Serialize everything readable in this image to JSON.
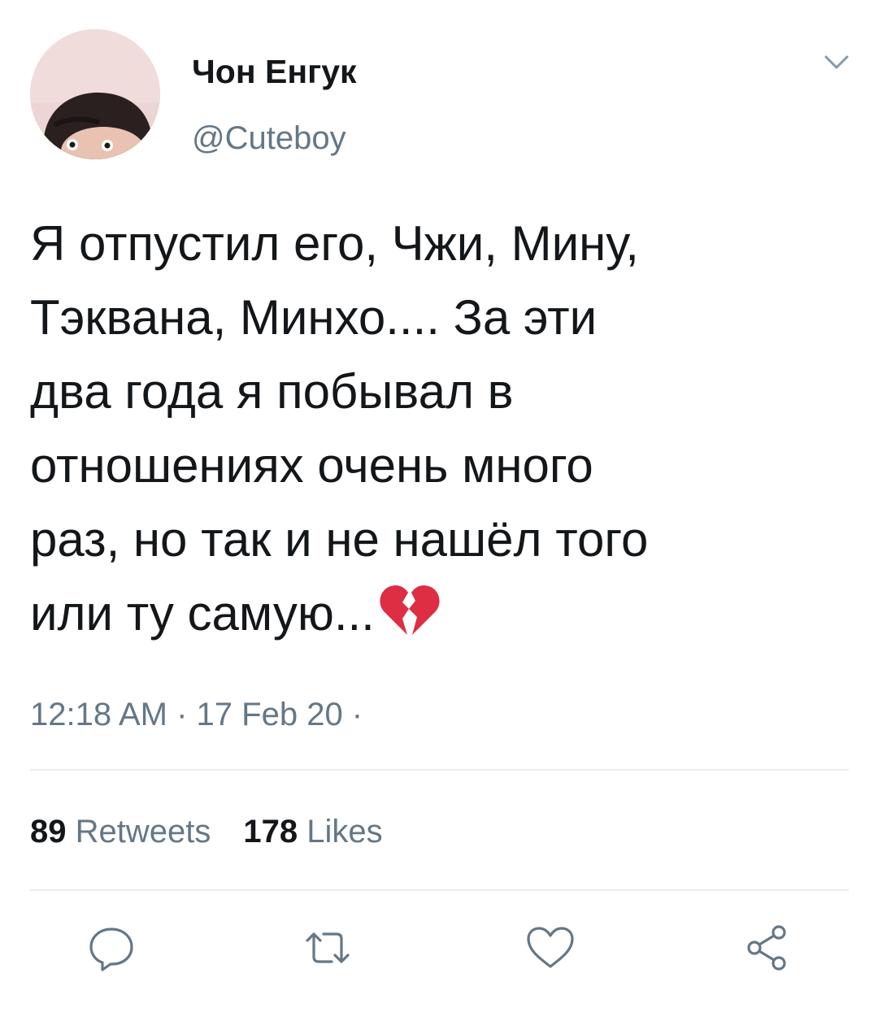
{
  "user": {
    "display_name": "Чон Енгук",
    "handle": "@Cuteboy",
    "avatar": "avatar-photo"
  },
  "tweet": {
    "lines": [
      "Я отпустил его, Чжи, Мину,",
      "Тэквана, Минхо.... За эти",
      "два года я побывал в",
      "отношениях очень много",
      "раз, но так и не нашёл того",
      "или ту самую..."
    ],
    "emoji": "broken-heart",
    "timestamp": "12:18 AM · 17 Feb 20 ·"
  },
  "stats": {
    "retweets_count": "89",
    "retweets_label": "Retweets",
    "likes_count": "178",
    "likes_label": "Likes"
  },
  "actions": {
    "reply": "reply-icon",
    "retweet": "retweet-icon",
    "like": "heart-icon",
    "share": "share-icon"
  },
  "colors": {
    "text": "#14171a",
    "secondary": "#657786",
    "divider": "#e6ecf0",
    "emoji_red": "#dd2e44"
  }
}
